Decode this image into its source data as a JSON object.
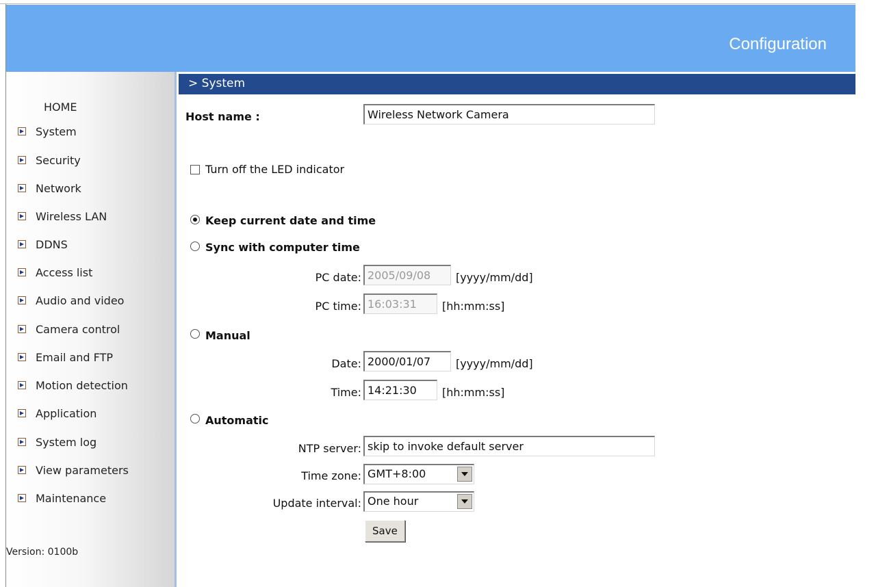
{
  "header": {
    "title": "Configuration"
  },
  "sidebar": {
    "home": "HOME",
    "items": [
      {
        "label": "System"
      },
      {
        "label": "Security"
      },
      {
        "label": "Network"
      },
      {
        "label": "Wireless LAN"
      },
      {
        "label": "DDNS"
      },
      {
        "label": "Access list"
      },
      {
        "label": "Audio and video"
      },
      {
        "label": "Camera control"
      },
      {
        "label": "Email and FTP"
      },
      {
        "label": "Motion detection"
      },
      {
        "label": "Application"
      },
      {
        "label": "System log"
      },
      {
        "label": "View parameters"
      },
      {
        "label": "Maintenance"
      }
    ],
    "version": "Version: 0100b"
  },
  "section": {
    "title": "> System"
  },
  "form": {
    "host_name_label": "Host name :",
    "host_name_value": "Wireless Network Camera",
    "led_label": "Turn off the LED indicator",
    "led_checked": false,
    "keep_label": "Keep current date and time",
    "sync_label": "Sync with computer time",
    "pc_date_label": "PC date:",
    "pc_date_value": "2005/09/08",
    "pc_date_format": "[yyyy/mm/dd]",
    "pc_time_label": "PC time:",
    "pc_time_value": "16:03:31",
    "pc_time_format": "[hh:mm:ss]",
    "manual_label": "Manual",
    "date_label": "Date:",
    "date_value": "2000/01/07",
    "date_format": "[yyyy/mm/dd]",
    "time_label": "Time:",
    "time_value": "14:21:30",
    "time_format": "[hh:mm:ss]",
    "automatic_label": "Automatic",
    "ntp_label": "NTP server:",
    "ntp_value": "skip to invoke default server",
    "tz_label": "Time zone:",
    "tz_value": "GMT+8:00",
    "interval_label": "Update interval:",
    "interval_value": "One hour",
    "save_label": "Save",
    "selected_mode": "keep"
  }
}
